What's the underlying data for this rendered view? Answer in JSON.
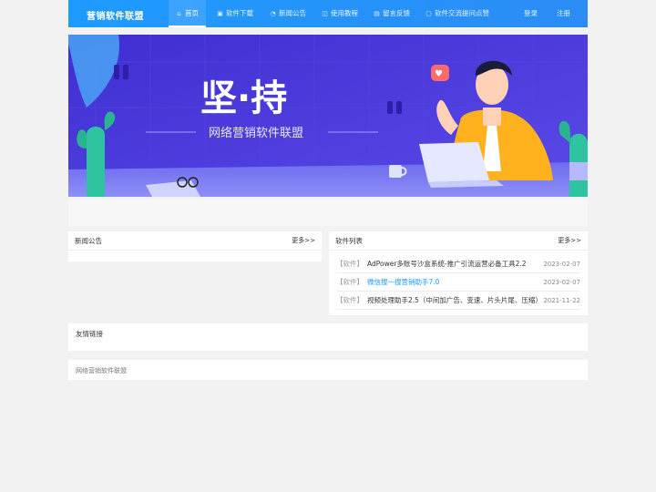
{
  "header": {
    "brand": "营销软件联盟",
    "nav": [
      {
        "label": "首页",
        "icon": "home-icon"
      },
      {
        "label": "软件下载",
        "icon": "download-icon"
      },
      {
        "label": "新闻公告",
        "icon": "bell-icon"
      },
      {
        "label": "使用教程",
        "icon": "book-icon"
      },
      {
        "label": "留言反馈",
        "icon": "feedback-icon"
      },
      {
        "label": "软件交流提问点赞",
        "icon": "chat-icon"
      }
    ],
    "login": "登录",
    "register": "注册"
  },
  "banner": {
    "headline": "坚·持",
    "subtitle": "网络营销软件联盟"
  },
  "news_panel": {
    "title": "新闻公告",
    "more": "更多>>"
  },
  "software_panel": {
    "title": "软件列表",
    "more": "更多>>",
    "items": [
      {
        "tag": "【软件】",
        "title": "AdPower多账号沙盒系统-推广引流运营必备工具2.2",
        "date": "2023-02-07"
      },
      {
        "tag": "【软件】",
        "title": "微信搜一搜营销助手7.0",
        "date": "2023-02-07"
      },
      {
        "tag": "【软件】",
        "title": "视频处理助手2.5（中间加广告、变速、片头片尾、压缩）",
        "date": "2021-11-22"
      }
    ]
  },
  "friend_links": {
    "title": "友情链接"
  },
  "footer": {
    "text": "网络营销软件联盟"
  },
  "colors": {
    "primary": "#1e9bff",
    "banner_bg": "#4a3cd6"
  }
}
